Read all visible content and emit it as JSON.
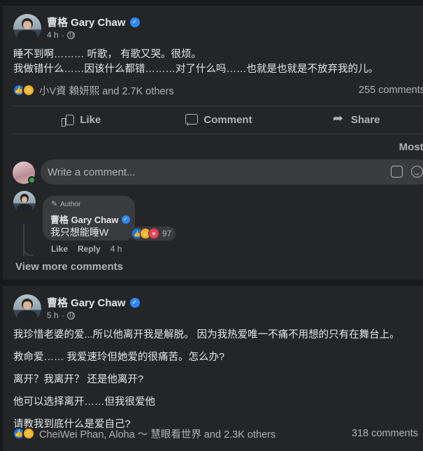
{
  "post1": {
    "author": "曹格 Gary Chaw",
    "time": "4 h",
    "lines": [
      "睡不到啊……… 听歌， 有歌又哭。很烦。",
      "我做错什么……因该什么都错………对了什么吗……也就是也就是不放弃我的儿。"
    ],
    "reactions_text": "小V資 賴妍熙 and 2.7K others",
    "comment_count": "255 comments",
    "actions": {
      "like": "Like",
      "comment": "Comment",
      "share": "Share"
    },
    "sort_label": "Most re",
    "write_placeholder": "Write a comment...",
    "top_comment": {
      "badge": "Author",
      "author": "曹格 Gary Chaw",
      "text": "我只想能睡W",
      "reaction_count": "97",
      "like": "Like",
      "reply": "Reply",
      "time": "4 h"
    },
    "view_more": "View more comments"
  },
  "post2": {
    "author": "曹格 Gary Chaw",
    "time": "5 h",
    "paragraphs": [
      "我珍惜老婆的爱...所以他离开我是解脱。 因为我热爱唯一不痛不用想的只有在舞台上。",
      "救命爱…… 我爱速玲但她爱的很痛苦。怎么办?",
      "离开？我离开？ 还是他离开?",
      "他可以选择离开……但我很爱他",
      "请教我到底什么是爱自己?"
    ],
    "reactions_text": "CheiWei Phan, Aloha ～ 慧眼看世界 and 2.3K others",
    "comment_count": "318 comments"
  },
  "icons": {
    "verified": "verified-badge-icon",
    "audience": "globe-icon",
    "like": "like-reaction-icon",
    "care": "care-reaction-icon",
    "love": "love-reaction-icon"
  },
  "colors": {
    "background": "#18191a",
    "card": "#242526",
    "accent": "#2d88ff"
  }
}
